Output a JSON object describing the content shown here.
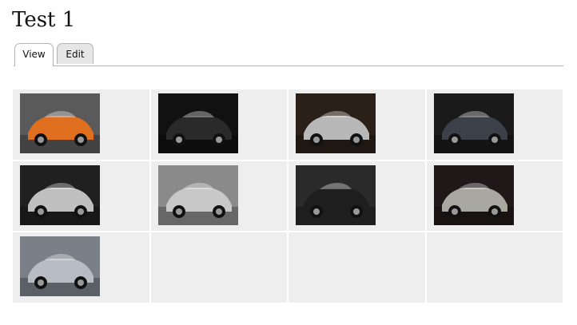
{
  "page": {
    "title": "Test 1"
  },
  "tabs": [
    {
      "label": "View",
      "active": true
    },
    {
      "label": "Edit",
      "active": false
    }
  ],
  "gallery": {
    "columns": 4,
    "images": [
      {
        "name": "orange-car-photo",
        "bg": "#5a5a5a",
        "car": "#e07020"
      },
      {
        "name": "gear-shift-photo",
        "bg": "#111111",
        "car": "#2a2a2a"
      },
      {
        "name": "silver-aston-martin-photo",
        "bg": "#2a2018",
        "car": "#b8b8b8"
      },
      {
        "name": "dark-car-showroom-photo",
        "bg": "#1a1a1a",
        "car": "#3c4048"
      },
      {
        "name": "wheel-rim-photo",
        "bg": "#202020",
        "car": "#c0c0c0"
      },
      {
        "name": "silver-porsche-photo",
        "bg": "#8a8a8a",
        "car": "#c8c8c8"
      },
      {
        "name": "black-bentley-photo",
        "bg": "#2a2a2a",
        "car": "#1e1e1e"
      },
      {
        "name": "silver-convertible-photo",
        "bg": "#201818",
        "car": "#a8a8a0"
      },
      {
        "name": "silver-dbs-photo",
        "bg": "#7a8088",
        "car": "#b8bcc4"
      }
    ]
  }
}
